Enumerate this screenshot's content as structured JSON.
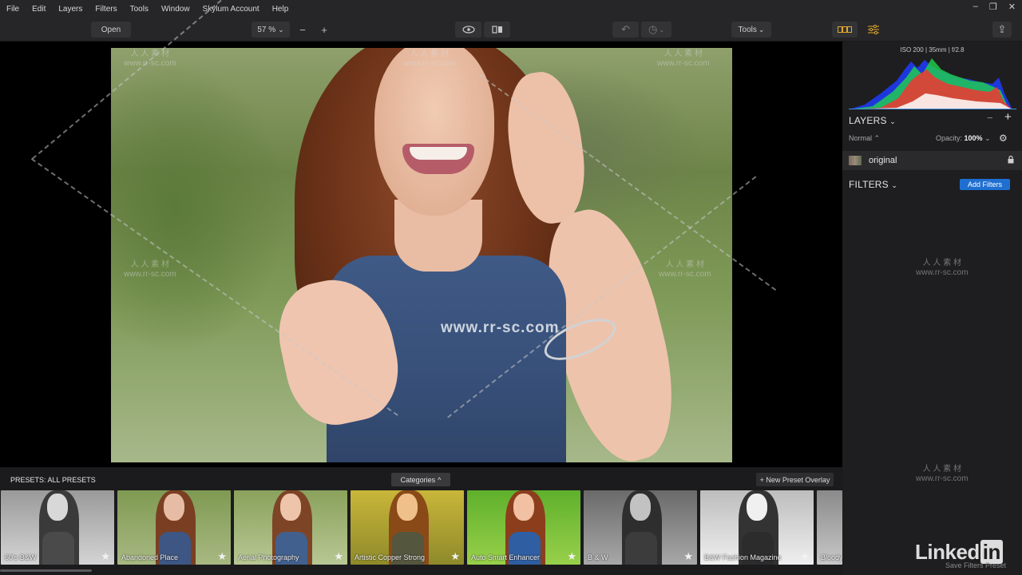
{
  "menu": {
    "items": [
      "File",
      "Edit",
      "Layers",
      "Filters",
      "Tools",
      "Window",
      "Skylum Account",
      "Help"
    ],
    "window_controls": [
      "–",
      "❐",
      "✕"
    ]
  },
  "toolbar": {
    "open_label": "Open",
    "zoom_value": "57 %",
    "zoom_caret": "⌄",
    "zoom_out": "−",
    "zoom_in": "+",
    "preview_icon": "👁",
    "compare_icon": "◧",
    "undo_icon": "↶",
    "history_icon": "◷",
    "tools_label": "Tools",
    "tools_caret": "⌄",
    "presets_panel_icon": "▭▭",
    "adjust_panel_icon": "≡",
    "share_icon": "⇪"
  },
  "watermarks": {
    "center": "www.rr-sc.com",
    "small_cn": "人 人 素 材",
    "small_url": "www.rr-sc.com"
  },
  "histogram": {
    "info": "ISO 200  |  35mm  |  f/2.8"
  },
  "layers": {
    "title": "LAYERS",
    "title_caret": "⌄",
    "minus": "−",
    "plus": "+",
    "blend_mode": "Normal",
    "blend_caret": "⌃",
    "opacity_label": "Opacity:",
    "opacity_value": "100%",
    "opacity_caret": "⌄",
    "settings_icon": "⚙",
    "layer_name": "original",
    "lock_icon": "🔒"
  },
  "filters": {
    "title": "FILTERS",
    "title_caret": "⌄",
    "add_label": "Add Filters"
  },
  "presets": {
    "title": "PRESETS: ALL PRESETS",
    "categories_label": "Categories",
    "categories_caret": "^",
    "new_overlay_label": "+ New Preset Overlay",
    "star_icon": "★",
    "items": [
      {
        "label": "60's B&W"
      },
      {
        "label": "Abandoned Place"
      },
      {
        "label": "Aerial Photography"
      },
      {
        "label": "Artistic Copper Strong"
      },
      {
        "label": "Auto Smart Enhancer"
      },
      {
        "label": "B & W"
      },
      {
        "label": "B&W Fashion Magazine"
      },
      {
        "label": "Bloody"
      }
    ]
  },
  "footer": {
    "linkedin": "Linked",
    "linkedin_in": "in",
    "save_preset": "Save Filters Preset"
  }
}
